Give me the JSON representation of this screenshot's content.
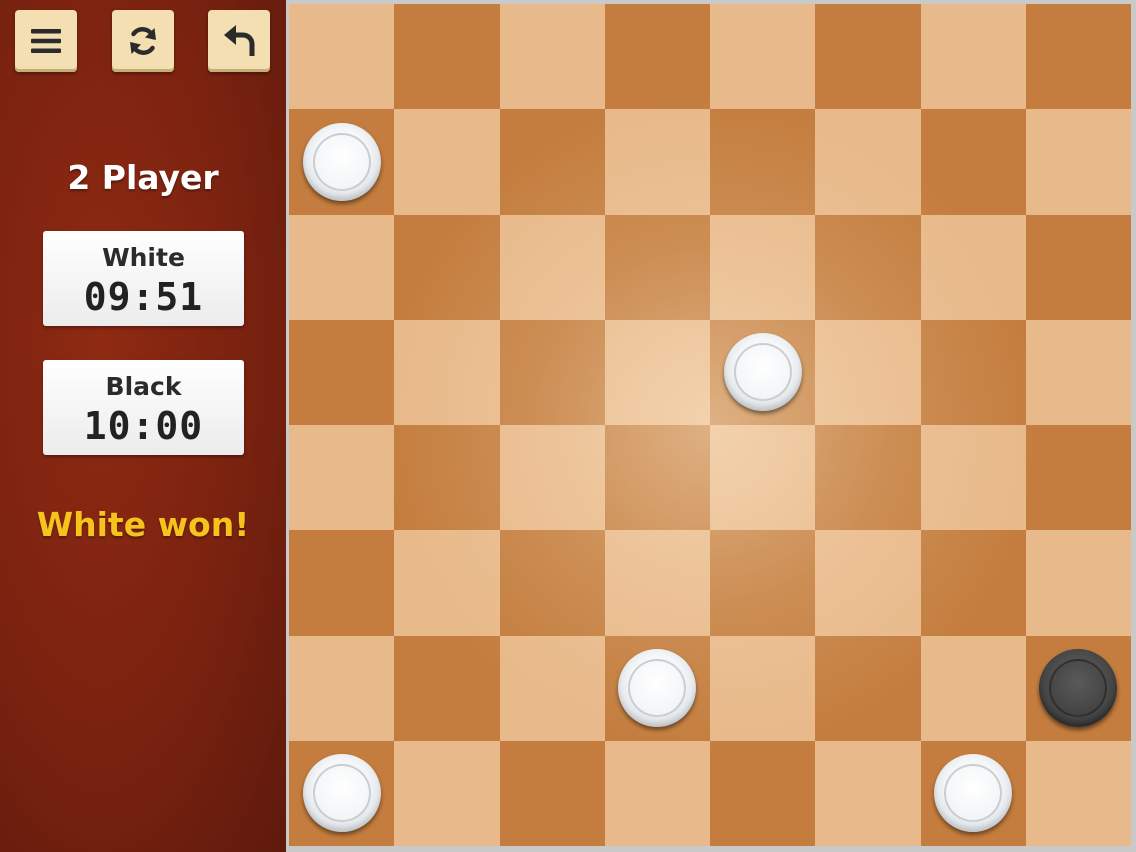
{
  "toolbar": {
    "menu_icon": "hamburger-menu-icon",
    "restart_icon": "refresh-icon",
    "undo_icon": "undo-arrow-icon",
    "button_color": "#f3dfb2",
    "icon_color": "#2b2b2b"
  },
  "sidebar": {
    "mode_title": "2 Player",
    "background_color": "#7a2210",
    "timers": {
      "white": {
        "name": "White",
        "time": "09:51"
      },
      "black": {
        "name": "Black",
        "time": "10:00"
      }
    },
    "status": "White won!",
    "status_color": "#f6c21c"
  },
  "board": {
    "size": 8,
    "light_color": "#e8b98a",
    "dark_color": "#c47d3e",
    "pieces": [
      {
        "color": "white",
        "row": 1,
        "col": 0
      },
      {
        "color": "white",
        "row": 3,
        "col": 4
      },
      {
        "color": "white",
        "row": 6,
        "col": 3
      },
      {
        "color": "black",
        "row": 6,
        "col": 7
      },
      {
        "color": "white",
        "row": 7,
        "col": 0
      },
      {
        "color": "white",
        "row": 7,
        "col": 6
      }
    ]
  }
}
